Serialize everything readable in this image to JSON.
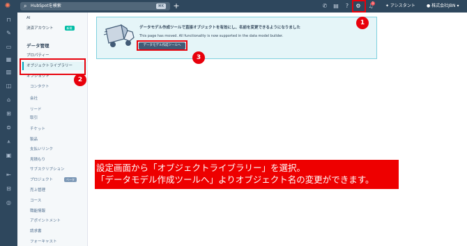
{
  "topbar": {
    "search_placeholder": "HubSpotを検索",
    "search_shortcut": "⌘K",
    "assistant_label": "アシスタント",
    "account_label": "株式会社JBN",
    "notification_count": "1"
  },
  "sidebar": {
    "items": [
      {
        "label": "AI"
      },
      {
        "label": "決済アカウント",
        "badge": "新規"
      },
      {
        "label": "データ管理"
      },
      {
        "label": "プロパティー"
      },
      {
        "label": "オブジェクトライブラリー"
      },
      {
        "label": "オブジェクト"
      },
      {
        "label": "コンタクト"
      },
      {
        "label": "会社"
      },
      {
        "label": "リード"
      },
      {
        "label": "取引"
      },
      {
        "label": "チケット"
      },
      {
        "label": "製品"
      },
      {
        "label": "支払いリンク"
      },
      {
        "label": "見積もり"
      },
      {
        "label": "サブスクリプション"
      },
      {
        "label": "プロジェクト",
        "badge": "ベータ"
      },
      {
        "label": "売上管理"
      },
      {
        "label": "コース"
      },
      {
        "label": "職能情報"
      },
      {
        "label": "アポイントメント"
      },
      {
        "label": "請求書"
      },
      {
        "label": "フォーキャスト"
      }
    ]
  },
  "banner": {
    "title": "データモデル作成ツールで直接オブジェクトを有効にし、名前を変更できるようになりました",
    "body": "This page has moved. All functionality is now supported in the data model builder.",
    "button_label": "データモデル作成ツールへ"
  },
  "markers": [
    "1",
    "2",
    "3"
  ],
  "caption": {
    "line1": "設定画面から「オブジェクトライブラリー」を選択。",
    "line2": "「データモデル作成ツールへ」よりオブジェクト名の変更ができます。"
  },
  "colors": {
    "topbar": "#2e475d",
    "accent": "#00a4bd",
    "annotation_red": "#e8000b",
    "caption_red": "#ee0000",
    "new_badge": "#00bda5",
    "beta_badge": "#7c98b6"
  }
}
